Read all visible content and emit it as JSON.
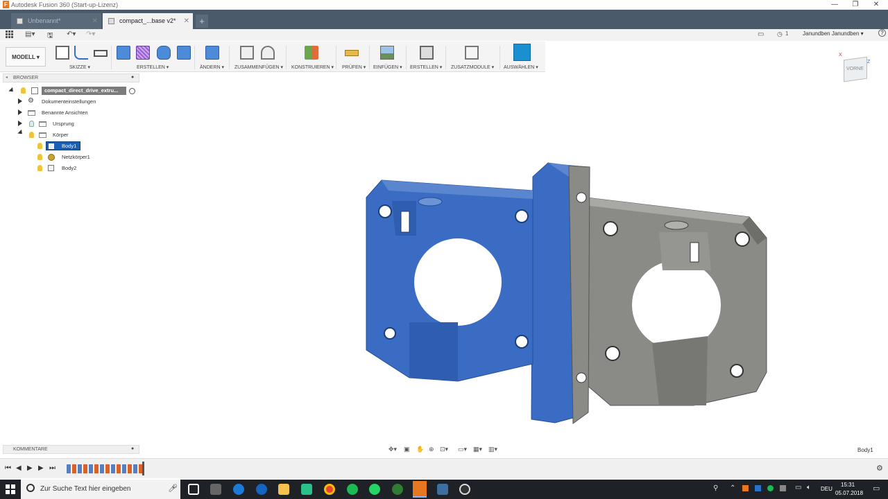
{
  "window": {
    "title": "Autodesk Fusion 360 (Start-up-Lizenz)",
    "logo_letter": "F",
    "minimize": "—",
    "maximize": "❐",
    "close": "✕"
  },
  "tabs": [
    {
      "label": "Unbenannt*",
      "active": false
    },
    {
      "label": "compact_...base v2*",
      "active": true
    }
  ],
  "new_tab": "+",
  "qat": {
    "jobs_count": "1",
    "user": "Janundben Janundben ▾",
    "help": "?"
  },
  "ribbon": {
    "workspace": "MODELL ▾",
    "groups": [
      {
        "label": "SKIZZE ▾"
      },
      {
        "label": "ERSTELLEN ▾"
      },
      {
        "label": "ÄNDERN ▾"
      },
      {
        "label": "ZUSAMMENFÜGEN ▾"
      },
      {
        "label": "KONSTRUIEREN ▾"
      },
      {
        "label": "PRÜFEN ▾"
      },
      {
        "label": "EINFÜGEN ▾"
      },
      {
        "label": "ERSTELLEN ▾"
      },
      {
        "label": "ZUSATZMODULE ▾"
      },
      {
        "label": "AUSWÄHLEN ▾"
      }
    ]
  },
  "browser": {
    "title": "BROWSER",
    "root": "compact_direct_drive_extru...",
    "items": [
      {
        "label": "Dokumenteinstellungen"
      },
      {
        "label": "Benannte Ansichten"
      },
      {
        "label": "Ursprung"
      },
      {
        "label": "Körper"
      },
      {
        "label": "Body1",
        "selected": true
      },
      {
        "label": "Netzkörper1"
      },
      {
        "label": "Body2"
      }
    ]
  },
  "comments": {
    "title": "KOMMENTARE"
  },
  "viewcube": {
    "face": "VORNE",
    "axis_x": "X",
    "axis_z": "Z"
  },
  "status": {
    "selection": "Body1"
  },
  "taskbar": {
    "search_placeholder": "Zur Suche Text hier eingeben",
    "language": "DEU",
    "time": "15:31",
    "date": "05.07.2018"
  },
  "colors": {
    "selection_blue": "#3a6cc4",
    "body_gray": "#8a8a86",
    "tab_bar": "#4b5a6a",
    "accent_orange": "#e87722"
  }
}
